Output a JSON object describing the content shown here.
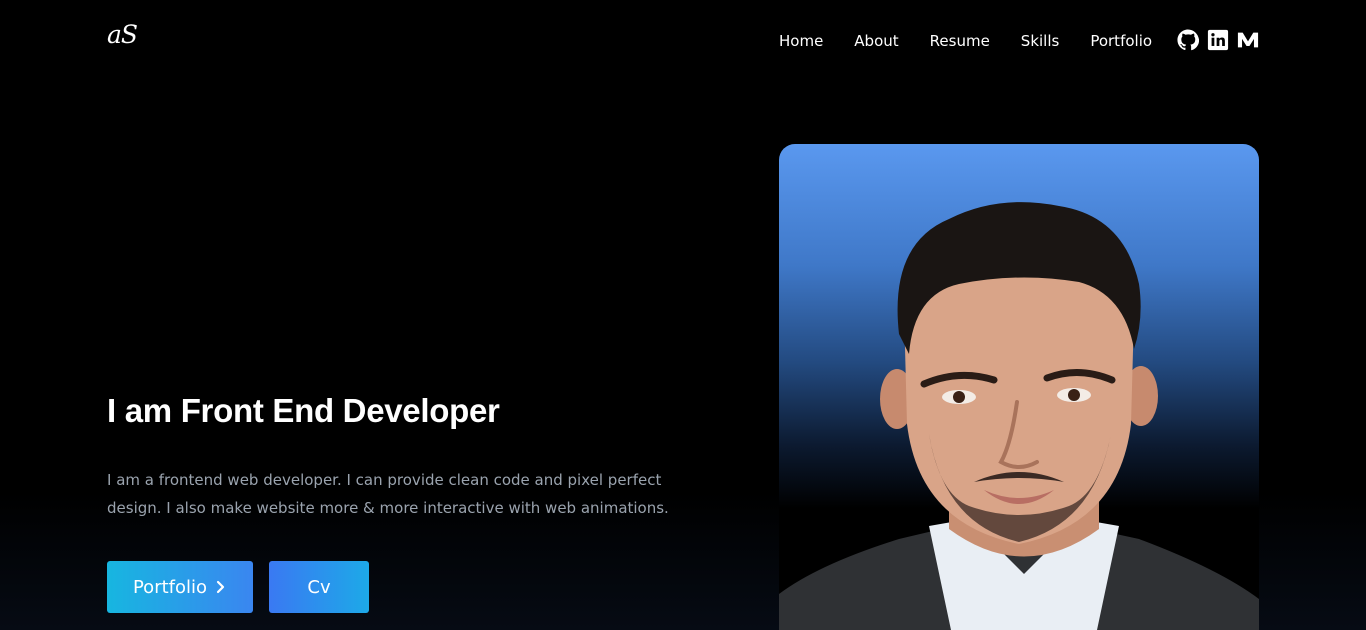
{
  "header": {
    "logo": "aS",
    "nav": [
      "Home",
      "About",
      "Resume",
      "Skills",
      "Portfolio"
    ],
    "socials": [
      "github-icon",
      "linkedin-icon",
      "medium-icon"
    ]
  },
  "hero": {
    "title": "I am Front End Developer",
    "description": "I am a frontend web developer. I can provide clean code and pixel perfect design. I also make website more & more interactive with web animations.",
    "buttons": {
      "portfolio": "Portfolio",
      "cv": "Cv"
    }
  },
  "colors": {
    "background": "#000000",
    "button_gradient_start": "#17b6e0",
    "button_gradient_end": "#3a86f0",
    "text_muted": "#9aa3ae"
  }
}
